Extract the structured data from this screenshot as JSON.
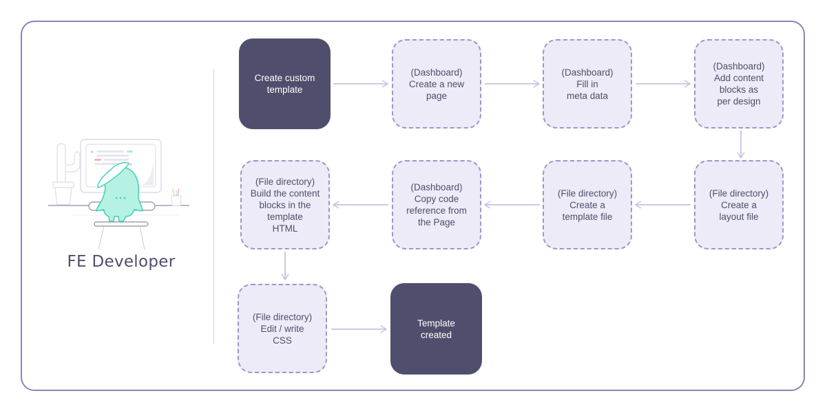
{
  "persona": {
    "label": "FE Developer",
    "illustration": "developer-at-computer-illustration"
  },
  "flow": {
    "nodes": [
      {
        "id": "n1",
        "type": "terminal",
        "text": "Create custom\ntemplate"
      },
      {
        "id": "n2",
        "type": "step",
        "text": "(Dashboard)\nCreate a new\npage"
      },
      {
        "id": "n3",
        "type": "step",
        "text": "(Dashboard)\nFill in\nmeta data"
      },
      {
        "id": "n4",
        "type": "step",
        "text": "(Dashboard)\nAdd content\nblocks as\nper design"
      },
      {
        "id": "n5",
        "type": "step",
        "text": "(File directory)\nCreate a\nlayout file"
      },
      {
        "id": "n6",
        "type": "step",
        "text": "(File directory)\nCreate a\ntemplate file"
      },
      {
        "id": "n7",
        "type": "step",
        "text": "(Dashboard)\nCopy code\nreference from\nthe Page"
      },
      {
        "id": "n8",
        "type": "step",
        "text": "(File directory)\nBuild the content\nblocks in the\ntemplate\nHTML"
      },
      {
        "id": "n9",
        "type": "step",
        "text": "(File directory)\nEdit / write\nCSS"
      },
      {
        "id": "n10",
        "type": "terminal",
        "text": "Template\ncreated"
      }
    ],
    "edges": [
      [
        "n1",
        "n2"
      ],
      [
        "n2",
        "n3"
      ],
      [
        "n3",
        "n4"
      ],
      [
        "n4",
        "n5"
      ],
      [
        "n5",
        "n6"
      ],
      [
        "n6",
        "n7"
      ],
      [
        "n7",
        "n8"
      ],
      [
        "n8",
        "n9"
      ],
      [
        "n9",
        "n10"
      ]
    ]
  },
  "colors": {
    "frame": "#8885b3",
    "terminal_fill": "#4f4f6d",
    "step_fill": "#ecebf7",
    "step_border": "#9a97c6",
    "arrow": "#c5c3e3",
    "accent_mint": "#b5f2e4"
  }
}
